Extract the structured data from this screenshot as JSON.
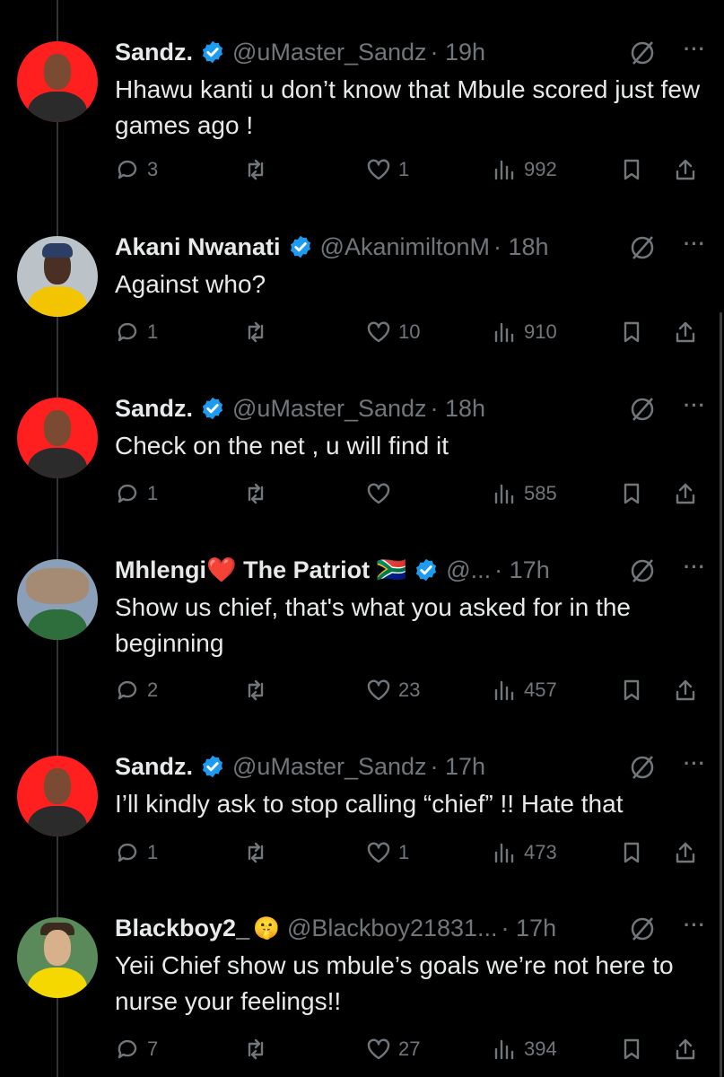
{
  "tweets": [
    {
      "name": "Sandz.",
      "emoji": "",
      "handle": "@uMaster_Sandz",
      "time": "· 19h",
      "text": "Hhawu kanti u don’t know that Mbule scored just few games ago !",
      "replies": "3",
      "retweets": "",
      "likes": "1",
      "views": "992",
      "avatar": {
        "bg": "#ff1f1f",
        "skin": "#7a4a32",
        "shirt": "#2b2b2b"
      }
    },
    {
      "name": "Akani Nwanati",
      "emoji": "",
      "handle": "@AkanimiltonM",
      "time": "· 18h",
      "text": "Against who?",
      "replies": "1",
      "retweets": "",
      "likes": "10",
      "views": "910",
      "avatar": {
        "bg": "#bcc3c8",
        "skin": "#4a3022",
        "shirt": "#f2c500"
      }
    },
    {
      "name": "Sandz.",
      "emoji": "",
      "handle": "@uMaster_Sandz",
      "time": "· 18h",
      "text": "Check on the net , u will find it",
      "replies": "1",
      "retweets": "",
      "likes": "",
      "views": "585",
      "avatar": {
        "bg": "#ff1f1f",
        "skin": "#7a4a32",
        "shirt": "#2b2b2b"
      }
    },
    {
      "name": "Mhlengi❤️ The Patriot 🇿🇦",
      "emoji": "",
      "handle": "@...",
      "time": "· 17h",
      "text": "Show us chief, that's what you asked for in the beginning",
      "replies": "2",
      "retweets": "",
      "likes": "23",
      "views": "457",
      "avatar": {
        "bg": "#8aa0b8",
        "skin": "#a58a74",
        "shirt": "#2d6e3c"
      }
    },
    {
      "name": "Sandz.",
      "emoji": "",
      "handle": "@uMaster_Sandz",
      "time": "· 17h",
      "text": "I’ll kindly ask to stop calling “chief” !! Hate that",
      "replies": "1",
      "retweets": "",
      "likes": "1",
      "views": "473",
      "avatar": {
        "bg": "#ff1f1f",
        "skin": "#7a4a32",
        "shirt": "#2b2b2b"
      }
    },
    {
      "name": "Blackboy2_",
      "emoji": "🤫",
      "handle": "@Blackboy21831...",
      "time": "· 17h",
      "text": "Yeii Chief show us mbule’s goals we’re not here to nurse your feelings!!",
      "replies": "7",
      "retweets": "",
      "likes": "27",
      "views": "394",
      "avatar": {
        "bg": "#5a8a5a",
        "skin": "#d9b08c",
        "shirt": "#f4d800"
      }
    }
  ],
  "colors": {
    "background": "#000000",
    "text": "#e7e9ea",
    "muted": "#71767b",
    "verified": "#1d9bf0"
  }
}
